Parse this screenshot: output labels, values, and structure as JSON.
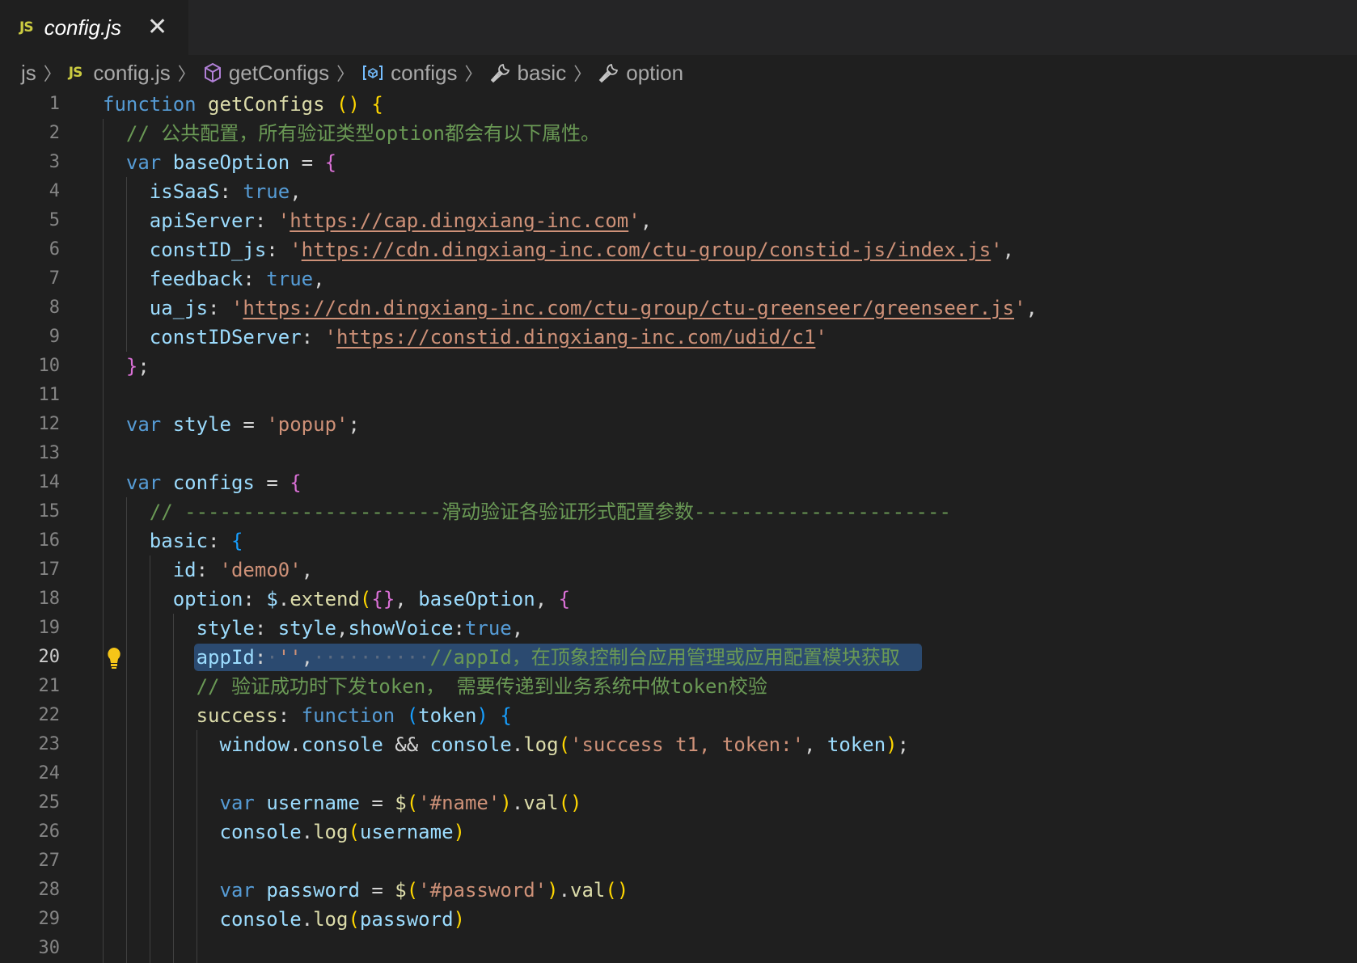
{
  "tab": {
    "icon": "js-file-icon",
    "badge": "JS",
    "title": "config.js",
    "close_icon": "close-icon"
  },
  "breadcrumb": [
    {
      "label": "js",
      "icon": ""
    },
    {
      "label": "config.js",
      "icon": "js-file-icon",
      "badge": "JS"
    },
    {
      "label": "getConfigs",
      "icon": "method-cube-icon"
    },
    {
      "label": "configs",
      "icon": "variable-icon"
    },
    {
      "label": "basic",
      "icon": "wrench-property-icon"
    },
    {
      "label": "option",
      "icon": "wrench-property-icon"
    }
  ],
  "colors": {
    "keyword": "#569cd6",
    "function": "#dcdcaa",
    "variable": "#9cdcfe",
    "string": "#ce9178",
    "comment": "#6a9955",
    "selection": "#2b4a70",
    "background": "#1f1f1f"
  },
  "editor": {
    "current_line": 20,
    "lightbulb_line": 20,
    "lines": [
      {
        "n": "1",
        "tokens": [
          [
            "k",
            "function"
          ],
          [
            "p",
            " "
          ],
          [
            "f",
            "getConfigs"
          ],
          [
            "p",
            " "
          ],
          [
            "y",
            "()"
          ],
          [
            "p",
            " "
          ],
          [
            "y",
            "{"
          ]
        ]
      },
      {
        "n": "2",
        "tokens": [
          [
            "p",
            "  "
          ],
          [
            "c",
            "// 公共配置，所有验证类型option都会有以下属性。"
          ]
        ]
      },
      {
        "n": "3",
        "tokens": [
          [
            "p",
            "  "
          ],
          [
            "k",
            "var"
          ],
          [
            "p",
            " "
          ],
          [
            "v",
            "baseOption"
          ],
          [
            "p",
            " = "
          ],
          [
            "m",
            "{"
          ]
        ]
      },
      {
        "n": "4",
        "tokens": [
          [
            "p",
            "    "
          ],
          [
            "v",
            "isSaaS"
          ],
          [
            "p",
            ": "
          ],
          [
            "k",
            "true"
          ],
          [
            "p",
            ","
          ]
        ]
      },
      {
        "n": "5",
        "tokens": [
          [
            "p",
            "    "
          ],
          [
            "v",
            "apiServer"
          ],
          [
            "p",
            ": "
          ],
          [
            "s",
            "'"
          ],
          [
            "u",
            "https://cap.dingxiang-inc.com"
          ],
          [
            "s",
            "'"
          ],
          [
            "p",
            ","
          ]
        ]
      },
      {
        "n": "6",
        "tokens": [
          [
            "p",
            "    "
          ],
          [
            "v",
            "constID_js"
          ],
          [
            "p",
            ": "
          ],
          [
            "s",
            "'"
          ],
          [
            "u",
            "https://cdn.dingxiang-inc.com/ctu-group/constid-js/index.js"
          ],
          [
            "s",
            "'"
          ],
          [
            "p",
            ","
          ]
        ]
      },
      {
        "n": "7",
        "tokens": [
          [
            "p",
            "    "
          ],
          [
            "v",
            "feedback"
          ],
          [
            "p",
            ": "
          ],
          [
            "k",
            "true"
          ],
          [
            "p",
            ","
          ]
        ]
      },
      {
        "n": "8",
        "tokens": [
          [
            "p",
            "    "
          ],
          [
            "v",
            "ua_js"
          ],
          [
            "p",
            ": "
          ],
          [
            "s",
            "'"
          ],
          [
            "u",
            "https://cdn.dingxiang-inc.com/ctu-group/ctu-greenseer/greenseer.js"
          ],
          [
            "s",
            "'"
          ],
          [
            "p",
            ","
          ]
        ]
      },
      {
        "n": "9",
        "tokens": [
          [
            "p",
            "    "
          ],
          [
            "v",
            "constIDServer"
          ],
          [
            "p",
            ": "
          ],
          [
            "s",
            "'"
          ],
          [
            "u",
            "https://constid.dingxiang-inc.com/udid/c1"
          ],
          [
            "s",
            "'"
          ]
        ]
      },
      {
        "n": "10",
        "tokens": [
          [
            "p",
            "  "
          ],
          [
            "m",
            "}"
          ],
          [
            "p",
            ";"
          ]
        ]
      },
      {
        "n": "11",
        "tokens": []
      },
      {
        "n": "12",
        "tokens": [
          [
            "p",
            "  "
          ],
          [
            "k",
            "var"
          ],
          [
            "p",
            " "
          ],
          [
            "v",
            "style"
          ],
          [
            "p",
            " = "
          ],
          [
            "s",
            "'popup'"
          ],
          [
            "p",
            ";"
          ]
        ]
      },
      {
        "n": "13",
        "tokens": []
      },
      {
        "n": "14",
        "tokens": [
          [
            "p",
            "  "
          ],
          [
            "k",
            "var"
          ],
          [
            "p",
            " "
          ],
          [
            "v",
            "configs"
          ],
          [
            "p",
            " = "
          ],
          [
            "m",
            "{"
          ]
        ]
      },
      {
        "n": "15",
        "tokens": [
          [
            "p",
            "    "
          ],
          [
            "c",
            "// ----------------------滑动验证各验证形式配置参数----------------------"
          ]
        ]
      },
      {
        "n": "16",
        "tokens": [
          [
            "p",
            "    "
          ],
          [
            "v",
            "basic"
          ],
          [
            "p",
            ": "
          ],
          [
            "b",
            "{"
          ]
        ]
      },
      {
        "n": "17",
        "tokens": [
          [
            "p",
            "      "
          ],
          [
            "v",
            "id"
          ],
          [
            "p",
            ": "
          ],
          [
            "s",
            "'demo0'"
          ],
          [
            "p",
            ","
          ]
        ]
      },
      {
        "n": "18",
        "tokens": [
          [
            "p",
            "      "
          ],
          [
            "v",
            "option"
          ],
          [
            "p",
            ": "
          ],
          [
            "v",
            "$"
          ],
          [
            "p",
            "."
          ],
          [
            "f",
            "extend"
          ],
          [
            "y",
            "("
          ],
          [
            "m",
            "{}"
          ],
          [
            "p",
            ", "
          ],
          [
            "v",
            "baseOption"
          ],
          [
            "p",
            ", "
          ],
          [
            "m",
            "{"
          ]
        ]
      },
      {
        "n": "19",
        "tokens": [
          [
            "p",
            "        "
          ],
          [
            "v",
            "style"
          ],
          [
            "p",
            ": "
          ],
          [
            "v",
            "style"
          ],
          [
            "p",
            ","
          ],
          [
            "v",
            "showVoice"
          ],
          [
            "p",
            ":"
          ],
          [
            "k",
            "true"
          ],
          [
            "p",
            ","
          ]
        ]
      },
      {
        "n": "20",
        "tokens": [
          [
            "p",
            "        "
          ],
          [
            "v",
            "appId"
          ],
          [
            "p",
            ":"
          ],
          [
            "d",
            "·"
          ],
          [
            "s",
            "''"
          ],
          [
            "p",
            ","
          ],
          [
            "d",
            "··········"
          ],
          [
            "c",
            "//appId，在顶象控制台应用管理或应用配置模块获取"
          ]
        ]
      },
      {
        "n": "21",
        "tokens": [
          [
            "p",
            "        "
          ],
          [
            "c",
            "// 验证成功时下发token， 需要传递到业务系统中做token校验"
          ]
        ]
      },
      {
        "n": "22",
        "tokens": [
          [
            "p",
            "        "
          ],
          [
            "f",
            "success"
          ],
          [
            "p",
            ": "
          ],
          [
            "k",
            "function"
          ],
          [
            "p",
            " "
          ],
          [
            "b",
            "("
          ],
          [
            "v",
            "token"
          ],
          [
            "b",
            ")"
          ],
          [
            "p",
            " "
          ],
          [
            "b",
            "{"
          ]
        ]
      },
      {
        "n": "23",
        "tokens": [
          [
            "p",
            "          "
          ],
          [
            "v",
            "window"
          ],
          [
            "p",
            "."
          ],
          [
            "v",
            "console"
          ],
          [
            "p",
            " && "
          ],
          [
            "v",
            "console"
          ],
          [
            "p",
            "."
          ],
          [
            "f",
            "log"
          ],
          [
            "y",
            "("
          ],
          [
            "s",
            "'success t1, token:'"
          ],
          [
            "p",
            ", "
          ],
          [
            "v",
            "token"
          ],
          [
            "y",
            ")"
          ],
          [
            "p",
            ";"
          ]
        ]
      },
      {
        "n": "24",
        "tokens": []
      },
      {
        "n": "25",
        "tokens": [
          [
            "p",
            "          "
          ],
          [
            "k",
            "var"
          ],
          [
            "p",
            " "
          ],
          [
            "v",
            "username"
          ],
          [
            "p",
            " = "
          ],
          [
            "f",
            "$"
          ],
          [
            "y",
            "("
          ],
          [
            "s",
            "'#name'"
          ],
          [
            "y",
            ")"
          ],
          [
            "p",
            "."
          ],
          [
            "f",
            "val"
          ],
          [
            "y",
            "()"
          ]
        ]
      },
      {
        "n": "26",
        "tokens": [
          [
            "p",
            "          "
          ],
          [
            "v",
            "console"
          ],
          [
            "p",
            "."
          ],
          [
            "f",
            "log"
          ],
          [
            "y",
            "("
          ],
          [
            "v",
            "username"
          ],
          [
            "y",
            ")"
          ]
        ]
      },
      {
        "n": "27",
        "tokens": []
      },
      {
        "n": "28",
        "tokens": [
          [
            "p",
            "          "
          ],
          [
            "k",
            "var"
          ],
          [
            "p",
            " "
          ],
          [
            "v",
            "password"
          ],
          [
            "p",
            " = "
          ],
          [
            "f",
            "$"
          ],
          [
            "y",
            "("
          ],
          [
            "s",
            "'#password'"
          ],
          [
            "y",
            ")"
          ],
          [
            "p",
            "."
          ],
          [
            "f",
            "val"
          ],
          [
            "y",
            "()"
          ]
        ]
      },
      {
        "n": "29",
        "tokens": [
          [
            "p",
            "          "
          ],
          [
            "v",
            "console"
          ],
          [
            "p",
            "."
          ],
          [
            "f",
            "log"
          ],
          [
            "y",
            "("
          ],
          [
            "v",
            "password"
          ],
          [
            "y",
            ")"
          ]
        ]
      },
      {
        "n": "30",
        "tokens": []
      }
    ]
  }
}
